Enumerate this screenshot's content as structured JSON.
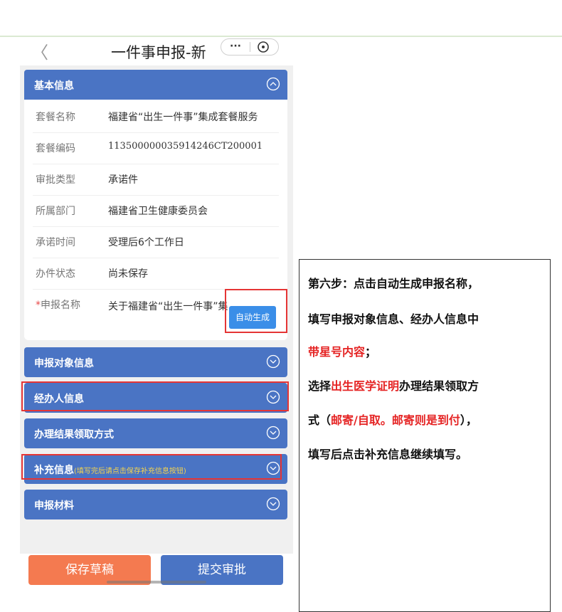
{
  "nav": {
    "back_glyph": "〈",
    "title": "一件事申报-新",
    "more_glyph": "···"
  },
  "basic_info": {
    "title": "基本信息",
    "rows": [
      {
        "label": "套餐名称",
        "value": "福建省“出生一件事”集成套餐服务"
      },
      {
        "label": "套餐编码",
        "value": "113500000035914246CT200001"
      },
      {
        "label": "审批类型",
        "value": "承诺件"
      },
      {
        "label": "所属部门",
        "value": "福建省卫生健康委员会"
      },
      {
        "label": "承诺时间",
        "value": "受理后6个工作日"
      },
      {
        "label": "办件状态",
        "value": "尚未保存"
      }
    ],
    "apply_name": {
      "required_mark": "*",
      "label": "申报名称",
      "value": "关于福建省“出生一件事”集"
    },
    "auto_generate_label": "自动生成"
  },
  "sections": [
    {
      "title": "申报对象信息",
      "hint": ""
    },
    {
      "title": "经办人信息",
      "hint": ""
    },
    {
      "title": "办理结果领取方式",
      "hint": ""
    },
    {
      "title": "补充信息",
      "hint": "(填写完后请点击保存补充信息按钮)"
    },
    {
      "title": "申报材料",
      "hint": ""
    }
  ],
  "footer": {
    "save_draft_label": "保存草稿",
    "submit_label": "提交审批"
  },
  "instruction": {
    "line1": "第六步：点击自动生成申报名称，",
    "line2": "填写申报对象信息、经办人信息中",
    "line3_red": "带星号内容",
    "line3_tail": "；",
    "line4_pre": "选择",
    "line4_red": "出生医学证明",
    "line4_tail": "办理结果领取方",
    "line5_pre": "式（",
    "line5_red": "邮寄/自取。邮寄则是到付",
    "line5_tail": "），",
    "line6": "填写后点击补充信息继续填写。"
  },
  "colors": {
    "section_blue": "#4a74c4",
    "draft_orange": "#f47a50",
    "highlight_red": "#e53535",
    "hint_yellow": "#f4d34e"
  }
}
